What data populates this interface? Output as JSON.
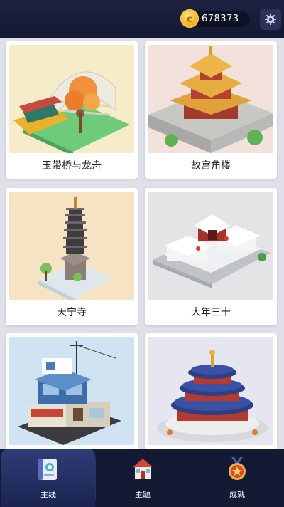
{
  "header": {
    "coins": "678373",
    "coin_icon": "coin-icon",
    "settings_icon": "gear-icon"
  },
  "levels": [
    {
      "title": "玉带桥与龙舟",
      "icon": "jade-belt-bridge-dragon-boat"
    },
    {
      "title": "故宫角楼",
      "icon": "forbidden-city-corner-tower"
    },
    {
      "title": "天宁寺",
      "icon": "tianning-temple-pagoda"
    },
    {
      "title": "大年三十",
      "icon": "new-years-eve-courtyard"
    },
    {
      "title": "",
      "icon": "blue-apartment-building"
    },
    {
      "title": "",
      "icon": "temple-of-heaven"
    }
  ],
  "tabs": [
    {
      "label": "主线",
      "icon": "book-map-icon",
      "active": true
    },
    {
      "label": "主题",
      "icon": "house-icon",
      "active": false
    },
    {
      "label": "成就",
      "icon": "medal-icon",
      "active": false
    }
  ],
  "colors": {
    "header_bg": "#1c2240",
    "tabbar_bg": "#141a33",
    "active_tab": "#2f3d78",
    "page_bg": "#dfe0ea"
  }
}
